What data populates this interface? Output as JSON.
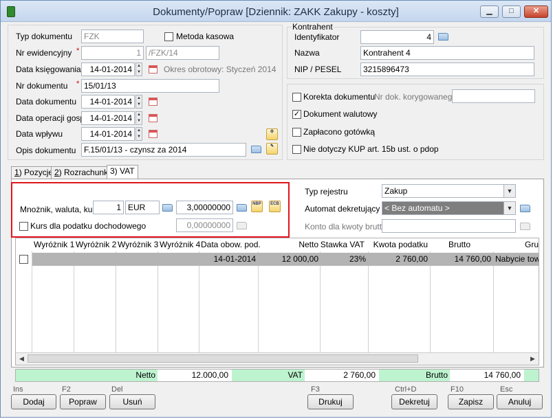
{
  "window": {
    "title": "Dokumenty/Popraw [Dziennik: ZAKK  Zakupy - koszty]",
    "controls": [
      "▁",
      "□",
      "✕"
    ]
  },
  "header": {
    "typ_dokumentu": {
      "label": "Typ dokumentu",
      "value": "FZK"
    },
    "metoda_kasowa": {
      "label": "Metoda kasowa",
      "checked": false
    },
    "nr_ewidencyjny": {
      "label": "Nr ewidencyjny",
      "number": "1",
      "suffix": "/FZK/14"
    },
    "data_ksiegowania": {
      "label": "Data księgowania",
      "value": "14-01-2014",
      "period": "Okres obrotowy: Styczeń 2014"
    },
    "nr_dokumentu": {
      "label": "Nr dokumentu",
      "value": "15/01/13"
    },
    "data_dokumentu": {
      "label": "Data dokumentu",
      "value": "14-01-2014"
    },
    "data_operacji": {
      "label": "Data operacji gosp.",
      "value": "14-01-2014"
    },
    "data_wplywu": {
      "label": "Data wpływu",
      "value": "14-01-2014"
    },
    "opis": {
      "label": "Opis dokumentu",
      "value": "F.15/01/13 - czynsz za 2014"
    },
    "required_mark": "*"
  },
  "kontrahent": {
    "group_label": "Kontrahent",
    "identyfikator": {
      "label": "Identyfikator",
      "value": "4"
    },
    "nazwa": {
      "label": "Nazwa",
      "value": "Kontrahent 4"
    },
    "nip": {
      "label": "NIP / PESEL",
      "value": "3215896473"
    }
  },
  "options": {
    "korekta": {
      "label": "Korekta dokumentu",
      "checked": false
    },
    "nr_dok_koryg": {
      "label": "Nr dok. korygowanego",
      "value": ""
    },
    "walutowy": {
      "label": "Dokument walutowy",
      "checked": true
    },
    "gotowka": {
      "label": "Zapłacono gotówką",
      "checked": false
    },
    "kup": {
      "label": "Nie dotyczy KUP art. 15b ust. o pdop",
      "checked": false
    }
  },
  "tabs": [
    {
      "key": "1",
      "rest": ") Pozycje"
    },
    {
      "key": "2",
      "rest": ") Rozrachunki"
    },
    {
      "key": "",
      "rest": "3) VAT"
    }
  ],
  "vat": {
    "mnoznik": {
      "label": "Mnożnik, waluta, kurs",
      "mult": "1",
      "currency": "EUR",
      "rate": "3,00000000"
    },
    "kurs_podatek": {
      "label": "Kurs dla podatku dochodowego",
      "checked": false,
      "rate": "0,00000000"
    },
    "nbp_icon": "NBP",
    "ecb_icon": "ECB",
    "typ_rejestru": {
      "label": "Typ rejestru",
      "value": "Zakup"
    },
    "automat": {
      "label": "Automat dekretujący",
      "value": "< Bez automatu >"
    },
    "konto_brutto": {
      "label": "Konto dla kwoty brutto",
      "value": ""
    }
  },
  "table": {
    "headers": [
      "Wyróżnik 1",
      "Wyróżnik 2",
      "Wyróżnik 3",
      "Wyróżnik 4",
      "Data obow. pod.",
      "Netto",
      "Stawka VAT",
      "Kwota podatku",
      "Brutto",
      "Grup"
    ],
    "rows": [
      {
        "data_obow": "14-01-2014",
        "netto": "12 000,00",
        "stawka": "23%",
        "kwota": "2 760,00",
        "brutto": "14 760,00",
        "grupa": "Nabycie towa"
      }
    ]
  },
  "summary": {
    "netto_label": "Netto",
    "netto": "12.000,00",
    "vat_label": "VAT",
    "vat": "2 760,00",
    "brutto_label": "Brutto",
    "brutto": "14 760,00"
  },
  "shortcuts": {
    "ins": "Ins",
    "f2": "F2",
    "del": "Del",
    "f3": "F3",
    "ctrld": "Ctrl+D",
    "f10": "F10",
    "esc": "Esc"
  },
  "buttons": {
    "dodaj": "Dodaj",
    "popraw": "Popraw",
    "usun": "Usuń",
    "drukuj": "Drukuj",
    "dekretuj": "Dekretuj",
    "zapisz": "Zapisz",
    "anuluj": "Anuluj"
  }
}
